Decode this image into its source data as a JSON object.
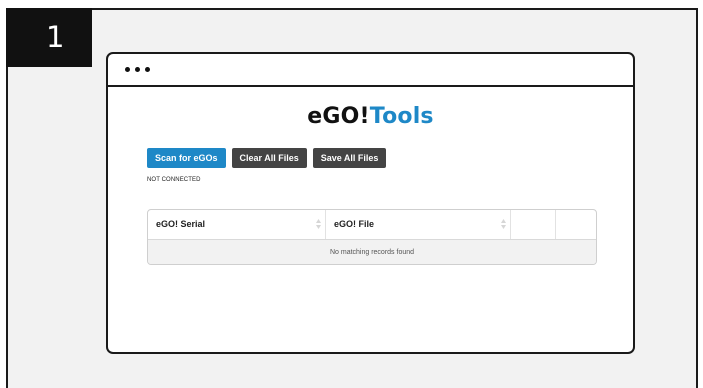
{
  "step_badge": "1",
  "app_title": {
    "brand": "eGO!",
    "accent": "Tools"
  },
  "toolbar": {
    "scan_label": "Scan for eGOs",
    "clear_label": "Clear All Files",
    "save_label": "Save All Files"
  },
  "status": "NOT CONNECTED",
  "table": {
    "columns": [
      "eGO! Serial",
      "eGO! File",
      "",
      ""
    ],
    "empty_message": "No matching records found"
  },
  "colors": {
    "accent": "#1e88c7",
    "dark_button": "#444444",
    "outer_background": "#f2f2f2",
    "badge": "#111111"
  },
  "icons": [
    "window-dots-icon",
    "sort-icon"
  ]
}
